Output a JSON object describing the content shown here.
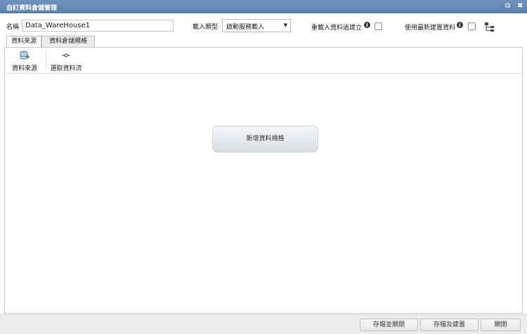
{
  "window": {
    "title": "自訂資料倉儲管理",
    "restore_glyph": "⧉",
    "close_glyph": "✖"
  },
  "form": {
    "name_label": "名稱",
    "name_value": "Data_WareHouse1",
    "load_type_label": "載入類型",
    "load_type_value": "啟動服務載入",
    "rebuild_label": "重載入資料過建立",
    "rebuild_checked": false,
    "use_latest_label": "使用最新建置資料",
    "use_latest_checked": false
  },
  "tabs": [
    {
      "label": "資料來源",
      "active": true
    },
    {
      "label": "資料倉儲規格",
      "active": false
    }
  ],
  "toolbar": {
    "datasource_label": "資料來源",
    "select_flow_label": "選取資料流"
  },
  "main": {
    "add_spec_label": "新增資料規格"
  },
  "footer": {
    "save_close_label": "存檔並關閉",
    "save_build_label": "存檔及建置",
    "close_label": "關閉"
  },
  "colors": {
    "titlebar": "#6285b2",
    "accent_icon": "#4f8f2f"
  }
}
